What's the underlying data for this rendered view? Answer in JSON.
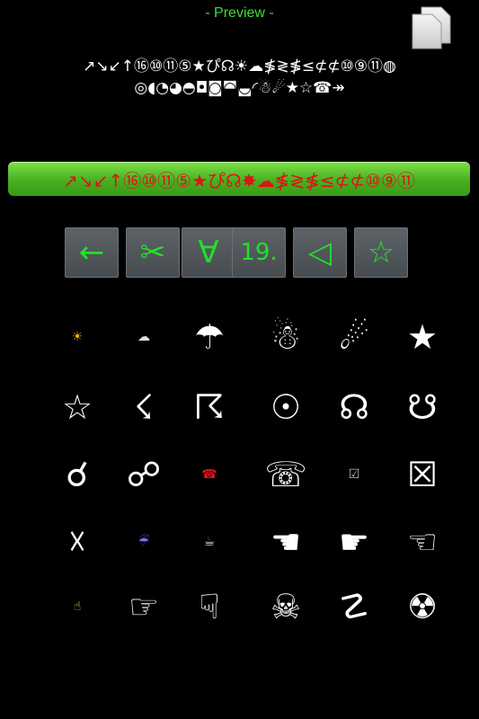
{
  "header": {
    "title": "- Preview -"
  },
  "preview": {
    "text": "↗↘↙↑⑯⑩⑪⑤★ぴ☊☀☁≸≷≸≤⊄⊄⑩⑨⑪◍\n◎◖◔◕◓◘◙◚◛◜☃☄★☆☎↠"
  },
  "green_bar": {
    "text": "↗↘↙↑⑯⑩⑪⑤★ぴ☊✸☁≸≷≸≤⊄⊄⑩⑨⑪"
  },
  "keys": [
    {
      "name": "left-arrow-key",
      "glyph": "←"
    },
    {
      "name": "scissors-key",
      "glyph": "✂"
    },
    {
      "name": "for-all-key",
      "glyph": "∀"
    },
    {
      "name": "number-19-key",
      "glyph": "19."
    },
    {
      "name": "triangle-key",
      "glyph": "◁"
    },
    {
      "name": "star-key",
      "glyph": "☆"
    }
  ],
  "symbols": [
    {
      "glyph": "☀",
      "name": "sun-icon",
      "size": "small",
      "color": "#f4b400"
    },
    {
      "glyph": "☁",
      "name": "cloud-icon",
      "size": "small",
      "color": "#ddd"
    },
    {
      "glyph": "☂",
      "name": "umbrella-icon",
      "size": "large"
    },
    {
      "glyph": "☃",
      "name": "snowman-icon",
      "size": "large"
    },
    {
      "glyph": "☄",
      "name": "comet-icon",
      "size": "large"
    },
    {
      "glyph": "★",
      "name": "black-star-icon",
      "size": "large"
    },
    {
      "glyph": "☆",
      "name": "white-star-icon",
      "size": "large"
    },
    {
      "glyph": "☇",
      "name": "lightning-icon",
      "size": "large"
    },
    {
      "glyph": "☈",
      "name": "thunderstorm-icon",
      "size": "large"
    },
    {
      "glyph": "☉",
      "name": "sun-symbol-icon",
      "size": "large"
    },
    {
      "glyph": "☊",
      "name": "ascending-node-icon",
      "size": "large"
    },
    {
      "glyph": "☋",
      "name": "descending-node-icon",
      "size": "large"
    },
    {
      "glyph": "☌",
      "name": "conjunction-icon",
      "size": "large"
    },
    {
      "glyph": "☍",
      "name": "opposition-icon",
      "size": "large"
    },
    {
      "glyph": "☎",
      "name": "red-telephone-icon",
      "size": "small",
      "color": "#e0121a"
    },
    {
      "glyph": "☏",
      "name": "telephone-icon",
      "size": "large"
    },
    {
      "glyph": "☑",
      "name": "checked-box-icon",
      "size": "small",
      "color": "#bbb"
    },
    {
      "glyph": "☒",
      "name": "x-box-icon",
      "size": "large"
    },
    {
      "glyph": "☓",
      "name": "saltire-icon",
      "size": "large"
    },
    {
      "glyph": "☔",
      "name": "umbrella-rain-icon",
      "size": "small",
      "color": "#8a6cff"
    },
    {
      "glyph": "☕",
      "name": "coffee-icon",
      "size": "small",
      "color": "#ddd"
    },
    {
      "glyph": "☚",
      "name": "hand-left-black-icon",
      "size": "large"
    },
    {
      "glyph": "☛",
      "name": "hand-right-black-icon",
      "size": "large"
    },
    {
      "glyph": "☜",
      "name": "hand-left-white-icon",
      "size": "large"
    },
    {
      "glyph": "☝",
      "name": "hand-up-icon",
      "size": "small",
      "color": "#f1c27d"
    },
    {
      "glyph": "☞",
      "name": "hand-right-white-icon",
      "size": "large"
    },
    {
      "glyph": "☟",
      "name": "hand-down-icon",
      "size": "large"
    },
    {
      "glyph": "☠",
      "name": "skull-icon",
      "size": "large"
    },
    {
      "glyph": "☡",
      "name": "caution-icon",
      "size": "large"
    },
    {
      "glyph": "☢",
      "name": "radioactive-icon",
      "size": "large"
    }
  ]
}
